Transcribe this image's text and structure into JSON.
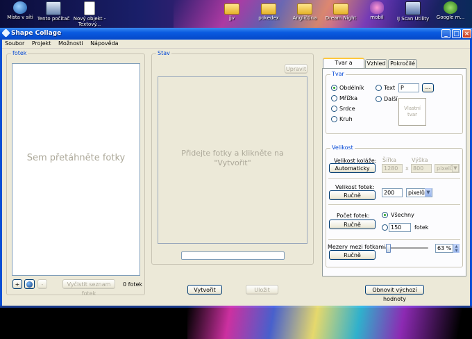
{
  "desktop": {
    "icons": [
      {
        "label": "Místa v síti",
        "icon": "network-places-icon"
      },
      {
        "label": "Tento počítač",
        "icon": "my-computer-icon"
      },
      {
        "label": "Nový objekt - Textový...",
        "icon": "text-document-icon"
      },
      {
        "label": "jjv",
        "icon": "folder-icon"
      },
      {
        "label": "pokedex",
        "icon": "folder-icon"
      },
      {
        "label": "Angličtina",
        "icon": "folder-icon"
      },
      {
        "label": "Dream Night",
        "icon": "folder-icon"
      },
      {
        "label": "mobil",
        "icon": "butterfly-icon"
      },
      {
        "label": "IJ Scan Utility",
        "icon": "scan-utility-icon"
      },
      {
        "label": "Google m...",
        "icon": "google-icon"
      }
    ]
  },
  "window": {
    "title": "Shape Collage",
    "controls": {
      "minimize": "_",
      "maximize": "□",
      "close": "×"
    }
  },
  "menu": [
    "Soubor",
    "Projekt",
    "Možnosti",
    "Nápověda"
  ],
  "photos": {
    "legend": "fotek",
    "drop_hint": "Sem přetáhněte fotky",
    "add_button": "+",
    "remove_button": "-",
    "clear_button": "Vyčistit seznam fotek",
    "count": "0 fotek"
  },
  "status": {
    "legend": "Stav",
    "edit_button": "Upravit",
    "hint": "Přidejte fotky a klikněte na \"Vytvořit\""
  },
  "actions": {
    "create": "Vytvořit",
    "save": "Uložit",
    "reset": "Obnovit výchozí hodnoty"
  },
  "tabs": [
    "Tvar a velikost",
    "Vzhled",
    "Pokročilé"
  ],
  "shape": {
    "legend": "Tvar",
    "options": [
      "Obdélník",
      "Mřížka",
      "Srdce",
      "Kruh"
    ],
    "selected": "Obdélník",
    "text_label": "Text",
    "text_value": "P",
    "browse": "...",
    "other_label": "Další",
    "custom_shape": "Vlastní tvar"
  },
  "size": {
    "legend": "Velikost",
    "collage_label": "Velikost koláže:",
    "collage_mode": "Automaticky",
    "width_label": "Šířka",
    "height_label": "Výška",
    "width": "1280",
    "times": "x",
    "height": "800",
    "unit": "pixelů",
    "photo_label": "Velikost fotek:",
    "photo_mode": "Ručně",
    "photo_size": "200",
    "photo_unit": "pixelů",
    "count_label": "Počet fotek:",
    "count_mode": "Ručně",
    "count_all": "Všechny",
    "count_value": "150",
    "count_unit": "fotek",
    "spacing_label": "Mezery mezi fotkami:",
    "spacing_mode": "Ručně",
    "spacing_percent": "63 %",
    "spacing_level": 0.1
  }
}
